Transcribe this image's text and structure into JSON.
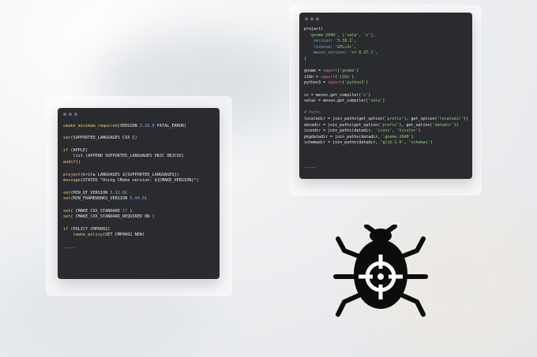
{
  "left_window": {
    "lines": [
      [
        {
          "t": "cmake_minimum_required",
          "c": "c-fn"
        },
        {
          "t": "(VERSION "
        },
        {
          "t": "3.16.0",
          "c": "c-num"
        },
        {
          "t": " FATAL_ERROR)"
        }
      ],
      [],
      [
        {
          "t": "set",
          "c": "c-fn"
        },
        {
          "t": "(SUPPORTED_LANGUAGES CXX C)"
        }
      ],
      [],
      [
        {
          "t": "if",
          "c": "c-fn"
        },
        {
          "t": " (APPLE)"
        }
      ],
      [
        {
          "t": "    list (APPEND SUPPORTED_LANGUAGES OBJC OBJCXX)"
        }
      ],
      [
        {
          "t": "endif",
          "c": "c-fn"
        },
        {
          "t": "()"
        }
      ],
      [],
      [
        {
          "t": "project",
          "c": "c-fn"
        },
        {
          "t": "(krita LANGUAGES ${SUPPORTED_LANGUAGES})"
        }
      ],
      [
        {
          "t": "message",
          "c": "c-fn"
        },
        {
          "t": "(STATUS \"Using CMake version: ${CMAKE_VERSION}\")"
        }
      ],
      [],
      [
        {
          "t": "set",
          "c": "c-fn"
        },
        {
          "t": "(MIN_QT_VERSION "
        },
        {
          "t": "5.12.0",
          "c": "c-num"
        },
        {
          "t": ")"
        }
      ],
      [
        {
          "t": "set",
          "c": "c-fn"
        },
        {
          "t": "(MIN_FRAMEWORKS_VERSION "
        },
        {
          "t": "5.44.0",
          "c": "c-num"
        },
        {
          "t": ")"
        }
      ],
      [],
      [
        {
          "t": "set",
          "c": "c-fn"
        },
        {
          "t": "( CMAKE_CXX_STANDARD "
        },
        {
          "t": "17",
          "c": "c-num"
        },
        {
          "t": " )"
        }
      ],
      [
        {
          "t": "set",
          "c": "c-fn"
        },
        {
          "t": "( CMAKE_CXX_STANDARD_REQUIRED ON )"
        }
      ],
      [],
      [
        {
          "t": "if",
          "c": "c-fn"
        },
        {
          "t": " (POLICY CMP0002)"
        }
      ],
      [
        {
          "t": "    "
        },
        {
          "t": "cmake_policy",
          "c": "c-fn"
        },
        {
          "t": "(SET CMP0002 NEW)"
        }
      ],
      [],
      [
        {
          "t": "....."
        }
      ]
    ]
  },
  "right_window": {
    "lines": [
      [
        {
          "t": "project("
        }
      ],
      [
        {
          "t": "  "
        },
        {
          "t": "'gnome-2048'",
          "c": "c-str"
        },
        {
          "t": ", "
        },
        {
          "t": "['vala', 'c']",
          "c": "c-str"
        },
        {
          "t": ","
        }
      ],
      [
        {
          "t": "    "
        },
        {
          "t": "version",
          "c": "c-key"
        },
        {
          "t": ": "
        },
        {
          "t": "'3.38.2'",
          "c": "c-str"
        },
        {
          "t": ","
        }
      ],
      [
        {
          "t": "    "
        },
        {
          "t": "license",
          "c": "c-key"
        },
        {
          "t": ": "
        },
        {
          "t": "'GPLv3+'",
          "c": "c-str"
        },
        {
          "t": ","
        }
      ],
      [
        {
          "t": "    "
        },
        {
          "t": "meson_version",
          "c": "c-key"
        },
        {
          "t": ": "
        },
        {
          "t": "'>= 0.37.1'",
          "c": "c-str"
        },
        {
          "t": ","
        }
      ],
      [
        {
          "t": ")"
        }
      ],
      [],
      [
        {
          "t": "gnome = "
        },
        {
          "t": "import",
          "c": "c-kw"
        },
        {
          "t": "("
        },
        {
          "t": "'gnome'",
          "c": "c-str"
        },
        {
          "t": ")"
        }
      ],
      [
        {
          "t": "i18n = "
        },
        {
          "t": "import",
          "c": "c-kw"
        },
        {
          "t": "("
        },
        {
          "t": "'i18n'",
          "c": "c-str"
        },
        {
          "t": ")"
        }
      ],
      [
        {
          "t": "python3 = "
        },
        {
          "t": "import",
          "c": "c-kw"
        },
        {
          "t": "("
        },
        {
          "t": "'python3'",
          "c": "c-str"
        },
        {
          "t": ")"
        }
      ],
      [],
      [
        {
          "t": "cc = meson.get_compiler("
        },
        {
          "t": "'c'",
          "c": "c-str"
        },
        {
          "t": ")"
        }
      ],
      [
        {
          "t": "valac = meson.get_compiler("
        },
        {
          "t": "'vala'",
          "c": "c-str"
        },
        {
          "t": ")"
        }
      ],
      [],
      [
        {
          "t": "# Paths",
          "c": "c-com"
        }
      ],
      [
        {
          "t": "localedir = join_paths(get_option("
        },
        {
          "t": "'prefix'",
          "c": "c-str"
        },
        {
          "t": "), get_option("
        },
        {
          "t": "'localedir'",
          "c": "c-str"
        },
        {
          "t": "))"
        }
      ],
      [
        {
          "t": "datadir = join_paths(get_option("
        },
        {
          "t": "'prefix'",
          "c": "c-str"
        },
        {
          "t": "), get_option("
        },
        {
          "t": "'datadir'",
          "c": "c-str"
        },
        {
          "t": "))"
        }
      ],
      [
        {
          "t": "icondir = join_paths(datadir, "
        },
        {
          "t": "'icons'",
          "c": "c-str"
        },
        {
          "t": ", "
        },
        {
          "t": "'hicolor'",
          "c": "c-str"
        },
        {
          "t": ")"
        }
      ],
      [
        {
          "t": "pkgdatadir = join_paths(datadir, "
        },
        {
          "t": "'gnome-2048'",
          "c": "c-str"
        },
        {
          "t": ")"
        }
      ],
      [
        {
          "t": "schemadir = join_paths(datadir, "
        },
        {
          "t": "'glib-2.0'",
          "c": "c-str"
        },
        {
          "t": ", "
        },
        {
          "t": "'schemas'",
          "c": "c-str"
        },
        {
          "t": ")"
        }
      ],
      [],
      [],
      [],
      [
        {
          "t": "....."
        }
      ]
    ]
  },
  "icons": {
    "bug": "bug-with-crosshair-icon"
  },
  "colors": {
    "editor_bg": "#2a2b2e",
    "function": "#f0c674",
    "number": "#9aa6f0",
    "keyword": "#e06c8a",
    "string": "#8fd17a",
    "key": "#5fb3d9",
    "comment": "#7b7d82"
  }
}
